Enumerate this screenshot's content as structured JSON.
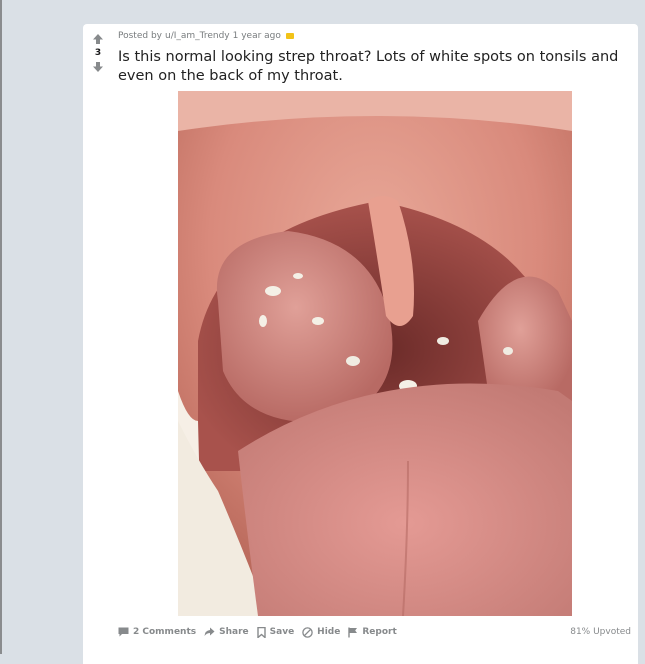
{
  "post": {
    "posted_by_prefix": "Posted by",
    "author": "u/I_am_Trendy",
    "age": "1 year ago",
    "score": "3",
    "title": "Is this normal looking strep throat? Lots of white spots on tonsils and even on the back of my throat.",
    "image_alt": "Photo of an open mouth showing swollen tonsils with white spots",
    "upvoted": "81% Upvoted"
  },
  "actions": {
    "comments": "2 Comments",
    "share": "Share",
    "save": "Save",
    "hide": "Hide",
    "report": "Report"
  },
  "icons": {
    "upvote": "arrow-up-icon",
    "downvote": "arrow-down-icon",
    "award": "award-icon",
    "comments": "comment-icon",
    "share": "share-icon",
    "save": "bookmark-icon",
    "hide": "hide-icon",
    "report": "flag-icon"
  },
  "colors": {
    "background": "#dae0e6",
    "card": "#ffffff",
    "award": "#f2c318",
    "action_text": "#878a8c"
  }
}
